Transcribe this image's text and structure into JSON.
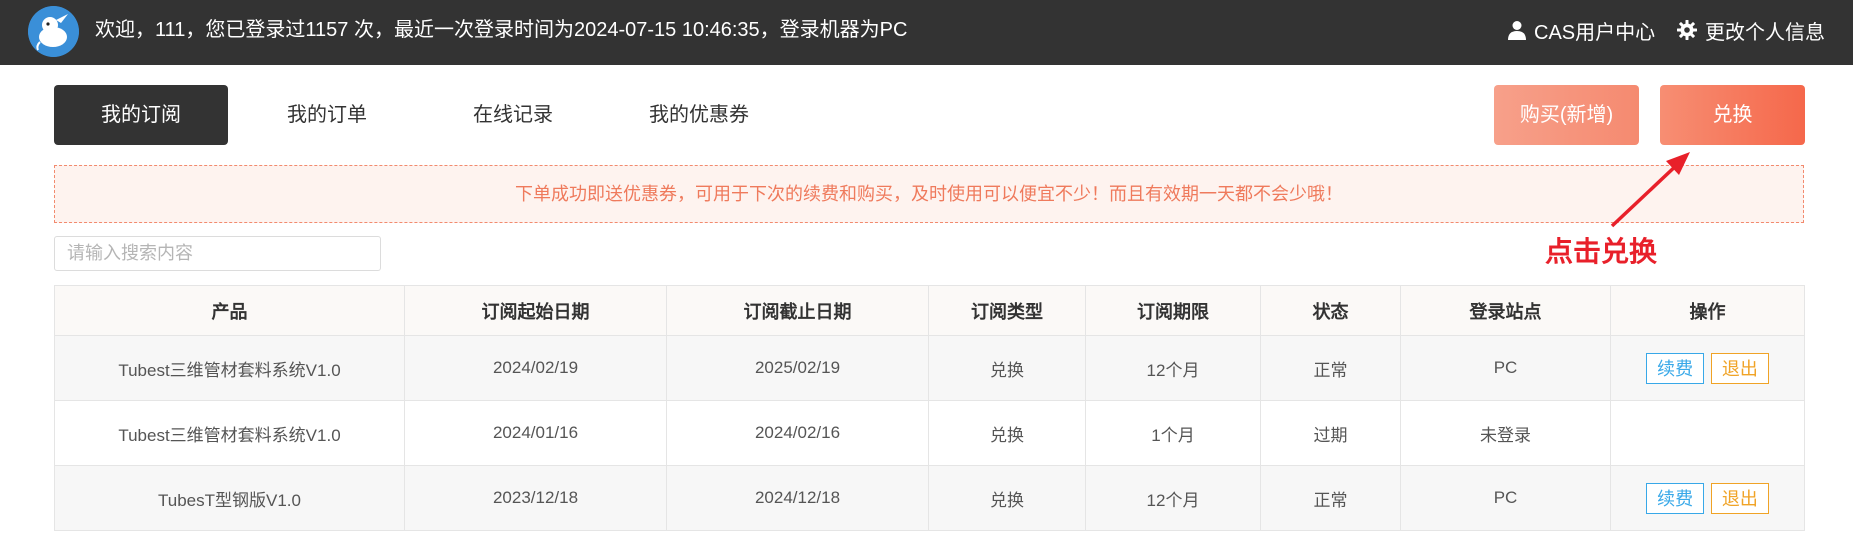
{
  "header": {
    "logo_icon": "mascot-logo-icon",
    "welcome_text": "欢迎，111，您已登录过1157 次，最近一次登录时间为2024-07-15 10:46:35，登录机器为PC",
    "cas_link": "CAS用户中心",
    "profile_link": "更改个人信息",
    "user_icon": "user-icon",
    "gear_icon": "gear-icon"
  },
  "tabs": [
    {
      "label": "我的订阅",
      "active": true
    },
    {
      "label": "我的订单",
      "active": false
    },
    {
      "label": "在线记录",
      "active": false
    },
    {
      "label": "我的优惠券",
      "active": false
    }
  ],
  "actions": {
    "buy_label": "购买(新增)",
    "redeem_label": "兑换"
  },
  "notice": "下单成功即送优惠券，可用于下次的续费和购买，及时使用可以便宜不少！而且有效期一天都不会少哦！",
  "annotation": "点击兑换",
  "search": {
    "placeholder": "请输入搜索内容",
    "value": ""
  },
  "table": {
    "headers": [
      "产品",
      "订阅起始日期",
      "订阅截止日期",
      "订阅类型",
      "订阅期限",
      "状态",
      "登录站点",
      "操作"
    ],
    "renew_label": "续费",
    "quit_label": "退出",
    "rows": [
      {
        "product": "Tubest三维管材套料系统V1.0",
        "start": "2024/02/19",
        "end": "2025/02/19",
        "type": "兑换",
        "term": "12个月",
        "status": "正常",
        "site": "PC"
      },
      {
        "product": "Tubest三维管材套料系统V1.0",
        "start": "2024/01/16",
        "end": "2024/02/16",
        "type": "兑换",
        "term": "1个月",
        "status": "过期",
        "site": "未登录"
      },
      {
        "product": "TubesT型钢版V1.0",
        "start": "2023/12/18",
        "end": "2024/12/18",
        "type": "兑换",
        "term": "12个月",
        "status": "正常",
        "site": "PC"
      }
    ]
  },
  "colors": {
    "header_bg": "#333333",
    "accent": "#f5684b",
    "status_normal": "#3aa63a",
    "status_expired": "#e8202a"
  }
}
